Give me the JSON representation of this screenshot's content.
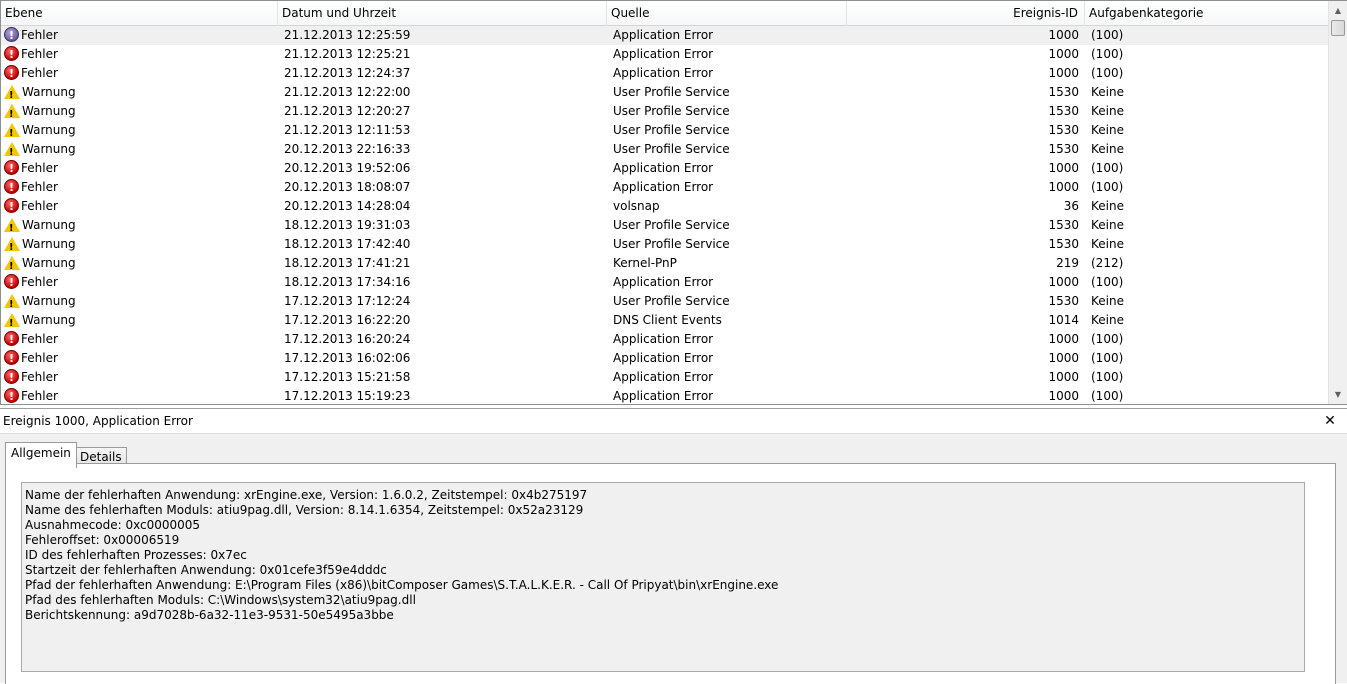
{
  "columns": {
    "level": "Ebene",
    "datetime": "Datum und Uhrzeit",
    "source": "Quelle",
    "event_id": "Ereignis-ID",
    "category": "Aufgabenkategorie"
  },
  "rows": [
    {
      "level": "Fehler",
      "type": "error",
      "datetime": "21.12.2013 12:25:59",
      "source": "Application Error",
      "id": "1000",
      "category": "(100)",
      "selected": true
    },
    {
      "level": "Fehler",
      "type": "error",
      "datetime": "21.12.2013 12:25:21",
      "source": "Application Error",
      "id": "1000",
      "category": "(100)"
    },
    {
      "level": "Fehler",
      "type": "error",
      "datetime": "21.12.2013 12:24:37",
      "source": "Application Error",
      "id": "1000",
      "category": "(100)"
    },
    {
      "level": "Warnung",
      "type": "warning",
      "datetime": "21.12.2013 12:22:00",
      "source": "User Profile Service",
      "id": "1530",
      "category": "Keine"
    },
    {
      "level": "Warnung",
      "type": "warning",
      "datetime": "21.12.2013 12:20:27",
      "source": "User Profile Service",
      "id": "1530",
      "category": "Keine"
    },
    {
      "level": "Warnung",
      "type": "warning",
      "datetime": "21.12.2013 12:11:53",
      "source": "User Profile Service",
      "id": "1530",
      "category": "Keine"
    },
    {
      "level": "Warnung",
      "type": "warning",
      "datetime": "20.12.2013 22:16:33",
      "source": "User Profile Service",
      "id": "1530",
      "category": "Keine"
    },
    {
      "level": "Fehler",
      "type": "error",
      "datetime": "20.12.2013 19:52:06",
      "source": "Application Error",
      "id": "1000",
      "category": "(100)"
    },
    {
      "level": "Fehler",
      "type": "error",
      "datetime": "20.12.2013 18:08:07",
      "source": "Application Error",
      "id": "1000",
      "category": "(100)"
    },
    {
      "level": "Fehler",
      "type": "error",
      "datetime": "20.12.2013 14:28:04",
      "source": "volsnap",
      "id": "36",
      "category": "Keine"
    },
    {
      "level": "Warnung",
      "type": "warning",
      "datetime": "18.12.2013 19:31:03",
      "source": "User Profile Service",
      "id": "1530",
      "category": "Keine"
    },
    {
      "level": "Warnung",
      "type": "warning",
      "datetime": "18.12.2013 17:42:40",
      "source": "User Profile Service",
      "id": "1530",
      "category": "Keine"
    },
    {
      "level": "Warnung",
      "type": "warning",
      "datetime": "18.12.2013 17:41:21",
      "source": "Kernel-PnP",
      "id": "219",
      "category": "(212)"
    },
    {
      "level": "Fehler",
      "type": "error",
      "datetime": "18.12.2013 17:34:16",
      "source": "Application Error",
      "id": "1000",
      "category": "(100)"
    },
    {
      "level": "Warnung",
      "type": "warning",
      "datetime": "17.12.2013 17:12:24",
      "source": "User Profile Service",
      "id": "1530",
      "category": "Keine"
    },
    {
      "level": "Warnung",
      "type": "warning",
      "datetime": "17.12.2013 16:22:20",
      "source": "DNS Client Events",
      "id": "1014",
      "category": "Keine"
    },
    {
      "level": "Fehler",
      "type": "error",
      "datetime": "17.12.2013 16:20:24",
      "source": "Application Error",
      "id": "1000",
      "category": "(100)"
    },
    {
      "level": "Fehler",
      "type": "error",
      "datetime": "17.12.2013 16:02:06",
      "source": "Application Error",
      "id": "1000",
      "category": "(100)"
    },
    {
      "level": "Fehler",
      "type": "error",
      "datetime": "17.12.2013 15:21:58",
      "source": "Application Error",
      "id": "1000",
      "category": "(100)"
    },
    {
      "level": "Fehler",
      "type": "error",
      "datetime": "17.12.2013 15:19:23",
      "source": "Application Error",
      "id": "1000",
      "category": "(100)"
    }
  ],
  "detail": {
    "title": "Ereignis 1000, Application Error",
    "close_glyph": "✕",
    "tabs": [
      "Allgemein",
      "Details"
    ],
    "lines": [
      "Name der fehlerhaften Anwendung: xrEngine.exe, Version: 1.6.0.2, Zeitstempel: 0x4b275197",
      "Name des fehlerhaften Moduls: atiu9pag.dll, Version: 8.14.1.6354, Zeitstempel: 0x52a23129",
      "Ausnahmecode: 0xc0000005",
      "Fehleroffset: 0x00006519",
      "ID des fehlerhaften Prozesses: 0x7ec",
      "Startzeit der fehlerhaften Anwendung: 0x01cefe3f59e4dddc",
      "Pfad der fehlerhaften Anwendung: E:\\Program Files (x86)\\bitComposer Games\\S.T.A.L.K.E.R. - Call Of Pripyat\\bin\\xrEngine.exe",
      "Pfad des fehlerhaften Moduls: C:\\Windows\\system32\\atiu9pag.dll",
      "Berichtskennung: a9d7028b-6a32-11e3-9531-50e5495a3bbe"
    ]
  },
  "colors": {
    "error": "#c40000",
    "error_selected": "#6a5a9a",
    "warning": "#f2c600",
    "selection": "#f0f0f0"
  }
}
